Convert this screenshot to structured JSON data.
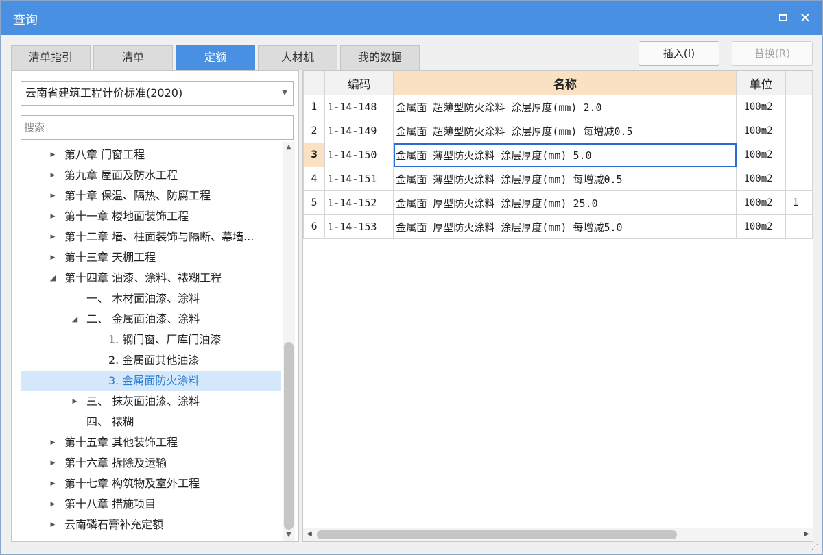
{
  "window": {
    "title": "查询"
  },
  "tabs": [
    {
      "label": "清单指引",
      "active": false
    },
    {
      "label": "清单",
      "active": false
    },
    {
      "label": "定额",
      "active": true
    },
    {
      "label": "人材机",
      "active": false
    },
    {
      "label": "我的数据",
      "active": false
    }
  ],
  "buttons": {
    "insert": "插入(I)",
    "replace": "替换(R)"
  },
  "standard_select": {
    "value": "云南省建筑工程计价标准(2020)"
  },
  "search": {
    "placeholder": "搜索"
  },
  "tree": [
    {
      "label": "第八章 门窗工程",
      "expander": "collapsed",
      "level": 0
    },
    {
      "label": "第九章 屋面及防水工程",
      "expander": "collapsed",
      "level": 0
    },
    {
      "label": "第十章 保温、隔热、防腐工程",
      "expander": "collapsed",
      "level": 0
    },
    {
      "label": "第十一章 楼地面装饰工程",
      "expander": "collapsed",
      "level": 0
    },
    {
      "label": "第十二章 墙、柱面装饰与隔断、幕墙...",
      "expander": "collapsed",
      "level": 0
    },
    {
      "label": "第十三章 天棚工程",
      "expander": "collapsed",
      "level": 0
    },
    {
      "label": "第十四章 油漆、涂料、裱糊工程",
      "expander": "expanded",
      "level": 0
    },
    {
      "label": "一、 木材面油漆、涂料",
      "expander": "none",
      "level": 1
    },
    {
      "label": "二、 金属面油漆、涂料",
      "expander": "expanded",
      "level": 1
    },
    {
      "label": "1. 钢门窗、厂库门油漆",
      "expander": "none",
      "level": 2
    },
    {
      "label": "2. 金属面其他油漆",
      "expander": "none",
      "level": 2
    },
    {
      "label": "3. 金属面防火涂料",
      "expander": "none",
      "level": 2,
      "selected": true
    },
    {
      "label": "三、 抹灰面油漆、涂料",
      "expander": "collapsed",
      "level": 1
    },
    {
      "label": "四、 裱糊",
      "expander": "none",
      "level": 1
    },
    {
      "label": "第十五章 其他装饰工程",
      "expander": "collapsed",
      "level": 0
    },
    {
      "label": "第十六章 拆除及运输",
      "expander": "collapsed",
      "level": 0
    },
    {
      "label": "第十七章 构筑物及室外工程",
      "expander": "collapsed",
      "level": 0
    },
    {
      "label": "第十八章 措施项目",
      "expander": "collapsed",
      "level": 0
    },
    {
      "label": "云南磷石膏补充定额",
      "expander": "collapsed",
      "level": 0
    }
  ],
  "table": {
    "columns": [
      "编码",
      "名称",
      "单位"
    ],
    "rows": [
      {
        "n": "1",
        "code": "1-14-148",
        "name": "金属面 超薄型防火涂料 涂层厚度(mm) 2.0",
        "unit": "100m2",
        "extra": ""
      },
      {
        "n": "2",
        "code": "1-14-149",
        "name": "金属面 超薄型防火涂料 涂层厚度(mm) 每增减0.5",
        "unit": "100m2",
        "extra": ""
      },
      {
        "n": "3",
        "code": "1-14-150",
        "name": "金属面 薄型防火涂料 涂层厚度(mm) 5.0",
        "unit": "100m2",
        "extra": "",
        "current": true
      },
      {
        "n": "4",
        "code": "1-14-151",
        "name": "金属面 薄型防火涂料 涂层厚度(mm) 每增减0.5",
        "unit": "100m2",
        "extra": ""
      },
      {
        "n": "5",
        "code": "1-14-152",
        "name": "金属面 厚型防火涂料 涂层厚度(mm) 25.0",
        "unit": "100m2",
        "extra": "1"
      },
      {
        "n": "6",
        "code": "1-14-153",
        "name": "金属面 厚型防火涂料 涂层厚度(mm) 每增减5.0",
        "unit": "100m2",
        "extra": ""
      }
    ]
  },
  "icons": {
    "maximize": "maximize-icon",
    "close": "close-icon",
    "dropdown": "chevron-down-icon",
    "expand": "triangle-right-icon",
    "collapse": "triangle-down-icon"
  }
}
